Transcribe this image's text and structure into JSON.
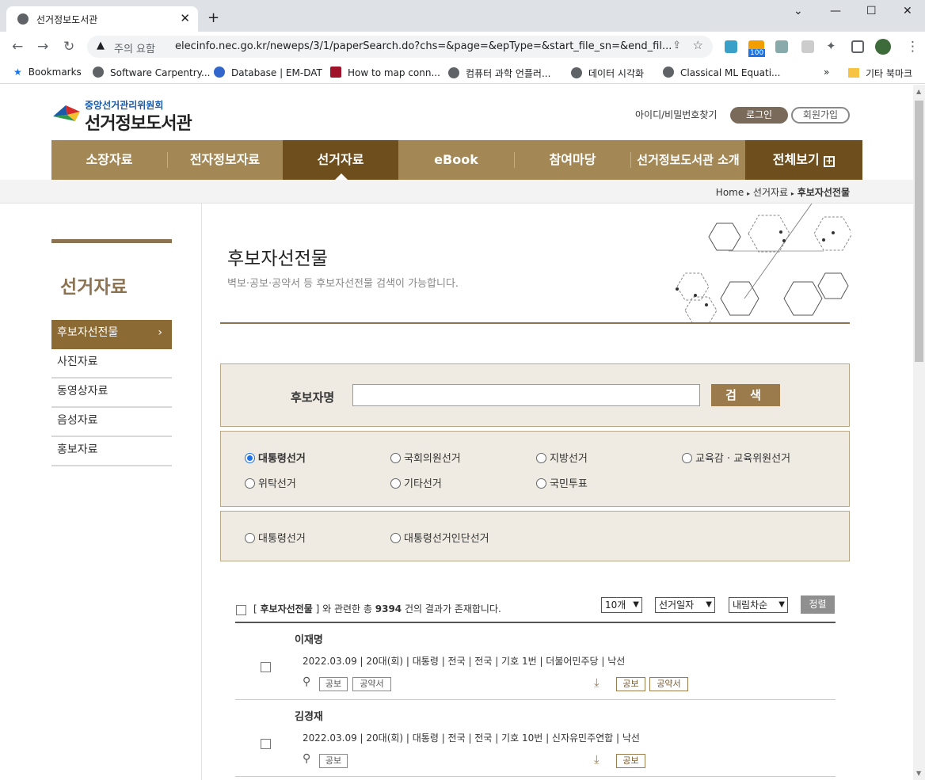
{
  "browser": {
    "tab_title": "선거정보도서관",
    "url": "elecinfo.nec.go.kr/neweps/3/1/paperSearch.do?chs=&page=&epType=&start_file_sn=&end_fil...",
    "security_label": "주의 요함",
    "bookmarks": [
      "Bookmarks",
      "Software Carpentry...",
      "Database | EM-DAT",
      "How to map conn...",
      "컴퓨터 과학 언플러...",
      "데이터 시각화",
      "Classical ML Equati..."
    ],
    "other_bookmarks": "기타 북마크",
    "badge": "100"
  },
  "site": {
    "logo_sub": "중앙선거관리위원회",
    "logo_main": "선거정보도서관",
    "find_id": "아이디/비밀번호찾기",
    "login": "로그인",
    "join": "회원가입"
  },
  "gnb": [
    "소장자료",
    "전자정보자료",
    "선거자료",
    "eBook",
    "참여마당",
    "선거정보도서관 소개",
    "전체보기"
  ],
  "breadcrumb": {
    "home": "Home",
    "parent": "선거자료",
    "current": "후보자선전물"
  },
  "lnb": {
    "title": "선거자료",
    "items": [
      "후보자선전물",
      "사진자료",
      "동영상자료",
      "음성자료",
      "홍보자료"
    ]
  },
  "content": {
    "title": "후보자선전물",
    "desc": "벽보·공보·공약서 등 후보자선전물 검색이 가능합니다."
  },
  "search": {
    "label": "후보자명",
    "value": "",
    "button": "검 색"
  },
  "election_types": [
    "대통령선거",
    "국회의원선거",
    "지방선거",
    "교육감 · 교육위원선거",
    "위탁선거",
    "기타선거",
    "국민투표"
  ],
  "election_selected": "대통령선거",
  "sub_types": [
    "대통령선거",
    "대통령선거인단선거"
  ],
  "results": {
    "prefix": "[",
    "category": "후보자선전물",
    "middle": "] 와 관련한 총",
    "count": "9394",
    "suffix": "건의 결과가 존재합니다.",
    "per_page": "10개",
    "sort_field": "선거일자",
    "sort_order": "내림차순",
    "sort_button": "정렬"
  },
  "items": [
    {
      "name": "이재명",
      "info": "2022.03.09 | 20대(회) | 대통령 | 전국 | 전국 | 기호 1번 | 더불어민주당 | 낙선",
      "view_tags": [
        "공보",
        "공약서"
      ],
      "download_tags": [
        "공보",
        "공약서"
      ]
    },
    {
      "name": "김경재",
      "info": "2022.03.09 | 20대(회) | 대통령 | 전국 | 전국 | 기호 10번 | 신자유민주연합 | 낙선",
      "view_tags": [
        "공보"
      ],
      "download_tags": [
        "공보"
      ]
    }
  ]
}
